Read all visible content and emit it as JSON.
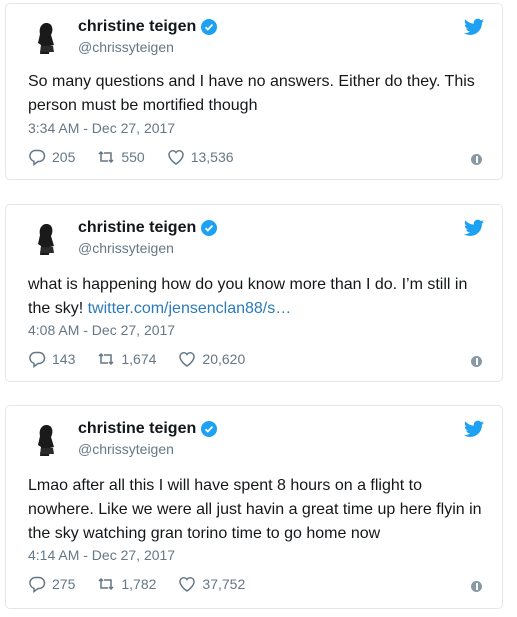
{
  "tweets": [
    {
      "name": "christine teigen",
      "handle": "@chrissyteigen",
      "text": "So many questions and I have no answers. Either do they. This\nperson must be mortified though",
      "link": "",
      "timestamp": "3:34 AM - Dec 27, 2017",
      "replies": "205",
      "retweets": "550",
      "likes": "13,536"
    },
    {
      "name": "christine teigen",
      "handle": "@chrissyteigen",
      "text": "what is happening how do you know more than I do. I’m still in\nthe sky! ",
      "link": "twitter.com/jensenclan88/s…",
      "timestamp": "4:08 AM - Dec 27, 2017",
      "replies": "143",
      "retweets": "1,674",
      "likes": "20,620"
    },
    {
      "name": "christine teigen",
      "handle": "@chrissyteigen",
      "text": "Lmao after all this I will have spent 8 hours on a flight to\nnowhere. Like we were all just havin a great time up here flyin in\nthe sky watching gran torino time to go home now",
      "link": "",
      "timestamp": "4:14 AM - Dec 27, 2017",
      "replies": "275",
      "retweets": "1,782",
      "likes": "37,752"
    }
  ],
  "colors": {
    "accent": "#1da1f2",
    "muted": "#657786",
    "link": "#2b7bb9",
    "border": "#e1e8ed"
  },
  "icons": [
    "verified-icon",
    "twitter-bird-icon",
    "reply-icon",
    "retweet-icon",
    "like-icon",
    "info-icon"
  ]
}
